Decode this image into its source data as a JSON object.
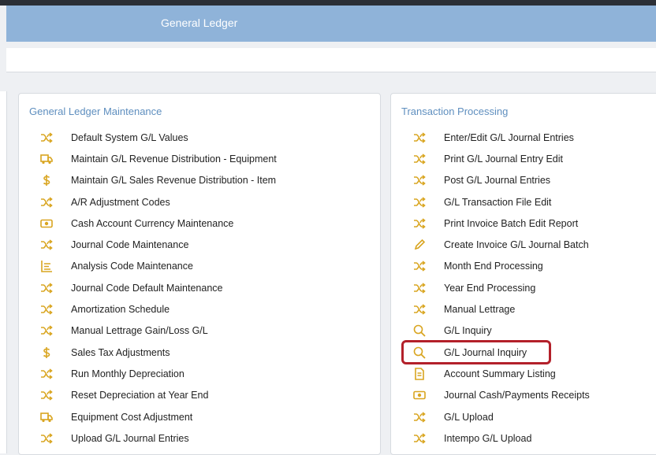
{
  "app": {
    "title": "General Ledger"
  },
  "colors": {
    "header_bg": "#8fb3d9",
    "icon": "#d9a520",
    "section_title": "#5f8fbf",
    "highlight": "#b3202a"
  },
  "sections": [
    {
      "title": "General Ledger Maintenance",
      "items": [
        {
          "label": "Default System G/L Values",
          "icon": "shuffle-icon"
        },
        {
          "label": "Maintain G/L Revenue Distribution - Equipment",
          "icon": "truck-icon"
        },
        {
          "label": "Maintain G/L Sales Revenue Distribution - Item",
          "icon": "dollar-icon"
        },
        {
          "label": "A/R Adjustment Codes",
          "icon": "shuffle-icon"
        },
        {
          "label": "Cash Account Currency Maintenance",
          "icon": "money-icon"
        },
        {
          "label": "Journal Code Maintenance",
          "icon": "shuffle-icon"
        },
        {
          "label": "Analysis Code Maintenance",
          "icon": "list-icon"
        },
        {
          "label": "Journal Code Default Maintenance",
          "icon": "shuffle-icon"
        },
        {
          "label": "Amortization Schedule",
          "icon": "shuffle-icon"
        },
        {
          "label": "Manual Lettrage Gain/Loss G/L",
          "icon": "shuffle-icon"
        },
        {
          "label": "Sales Tax Adjustments",
          "icon": "dollar-icon"
        },
        {
          "label": "Run Monthly Depreciation",
          "icon": "shuffle-icon"
        },
        {
          "label": "Reset Depreciation at Year End",
          "icon": "shuffle-icon"
        },
        {
          "label": "Equipment Cost Adjustment",
          "icon": "truck-icon"
        },
        {
          "label": "Upload G/L Journal Entries",
          "icon": "shuffle-icon"
        }
      ]
    },
    {
      "title": "Transaction Processing",
      "items": [
        {
          "label": "Enter/Edit G/L Journal Entries",
          "icon": "shuffle-icon"
        },
        {
          "label": "Print G/L Journal Entry Edit",
          "icon": "shuffle-icon"
        },
        {
          "label": "Post G/L Journal Entries",
          "icon": "shuffle-icon"
        },
        {
          "label": "G/L Transaction File Edit",
          "icon": "shuffle-icon"
        },
        {
          "label": "Print Invoice Batch Edit Report",
          "icon": "shuffle-icon"
        },
        {
          "label": "Create Invoice G/L Journal Batch",
          "icon": "pencil-icon"
        },
        {
          "label": "Month End Processing",
          "icon": "shuffle-icon"
        },
        {
          "label": "Year End Processing",
          "icon": "shuffle-icon"
        },
        {
          "label": "Manual Lettrage",
          "icon": "shuffle-icon"
        },
        {
          "label": "G/L Inquiry",
          "icon": "search-icon"
        },
        {
          "label": "G/L Journal Inquiry",
          "icon": "search-icon",
          "highlighted": true
        },
        {
          "label": "Account Summary Listing",
          "icon": "document-icon"
        },
        {
          "label": "Journal Cash/Payments Receipts",
          "icon": "money-icon"
        },
        {
          "label": "G/L Upload",
          "icon": "shuffle-icon"
        },
        {
          "label": "Intempo G/L Upload",
          "icon": "shuffle-icon"
        }
      ]
    }
  ]
}
